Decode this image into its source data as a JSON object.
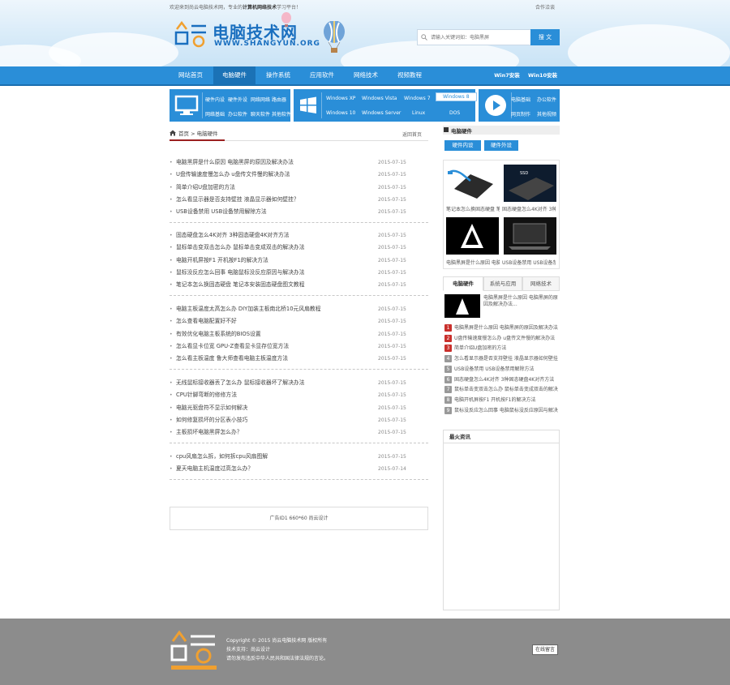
{
  "header": {
    "welcome_pre": "欢迎来到尚云电脑技术网，专业的",
    "welcome_bold": "计算机网络技术",
    "welcome_post": "学习平台！",
    "cooperation": "合作洽谈",
    "logo_cn": "电脑技术网",
    "logo_en": "WWW.SHANGYUN.ORG",
    "search_placeholder": "请输入关键词如：电脑黑屏",
    "search_button": "搜 文"
  },
  "nav": {
    "items": [
      "网站首页",
      "电脑硬件",
      "操作系统",
      "应用软件",
      "网络技术",
      "视频教程"
    ],
    "right": [
      "Win7安装",
      "Win10安装"
    ]
  },
  "categories": {
    "hardware": [
      "硬件内设",
      "硬件外设",
      "网络网络",
      "路由器",
      "网络基础",
      "办公软件",
      "聊天软件",
      "其他软件"
    ],
    "windows": [
      "Windows XP",
      "Windows Vista",
      "Windows 7",
      "Windows 8",
      "Windows 10",
      "Windows Server",
      "Linux",
      "DOS"
    ],
    "video": [
      "电脑基础",
      "办公软件",
      "网页制作",
      "其他视频"
    ]
  },
  "breadcrumb": {
    "home": "首页",
    "sep": ">",
    "current": "电脑硬件",
    "back": "返回首页"
  },
  "list": [
    [
      {
        "title": "电脑黑屏是什么原因 电脑黑屏的原因及解决办法",
        "date": "2015-07-15"
      },
      {
        "title": "U盘传输速度慢怎么办 u盘传文件慢的解决办法",
        "date": "2015-07-15"
      },
      {
        "title": "简单介绍U盘加密的方法",
        "date": "2015-07-15"
      },
      {
        "title": "怎么看显示器是否支持壁挂 液晶显示器如何壁挂？",
        "date": "2015-07-15"
      },
      {
        "title": "USB设备禁用 USB设备禁用解除方法",
        "date": "2015-07-15"
      }
    ],
    [
      {
        "title": "固态硬盘怎么4K对齐 3种固态硬盘4K对齐方法",
        "date": "2015-07-15"
      },
      {
        "title": "鼠标单击变双击怎么办 鼠标单击变成双击的解决办法",
        "date": "2015-07-15"
      },
      {
        "title": "电脑开机屏按F1 开机按F1的解决方法",
        "date": "2015-07-15"
      },
      {
        "title": "鼠标没反应怎么回事 电脑鼠标没反应原因与解决办法",
        "date": "2015-07-15"
      },
      {
        "title": "笔记本怎么换固态硬盘 笔记本安装固态硬盘图文教程",
        "date": "2015-07-15"
      }
    ],
    [
      {
        "title": "电脑主板温度太高怎么办 DIY加装主板南北桥10元风扇教程",
        "date": "2015-07-15"
      },
      {
        "title": "怎么查看电脑配置好不好",
        "date": "2015-07-15"
      },
      {
        "title": "有效优化电脑主板系统的BIOS设置",
        "date": "2015-07-15"
      },
      {
        "title": "怎么看显卡位宽 GPU-Z查看显卡显存位宽方法",
        "date": "2015-07-15"
      },
      {
        "title": "怎么看主板温度 鲁大师查看电脑主板温度方法",
        "date": "2015-07-15"
      }
    ],
    [
      {
        "title": "无线鼠标接收器丢了怎么办 鼠标接收器坏了解决办法",
        "date": "2015-07-15"
      },
      {
        "title": "CPU针脚弯断的修修方法",
        "date": "2015-07-15"
      },
      {
        "title": "电脑光驱盘符不显示如何解决",
        "date": "2015-07-15"
      },
      {
        "title": "如何修复损坏的分区表小技巧",
        "date": "2015-07-15"
      },
      {
        "title": "主板损坏电脑黑屏怎么办？",
        "date": "2015-07-15"
      }
    ],
    [
      {
        "title": "cpu风扇怎么拆，如何拆cpu风扇图解",
        "date": "2015-07-15"
      },
      {
        "title": "夏天电脑主机温度过高怎么办？",
        "date": "2015-07-14"
      }
    ]
  ],
  "ad": "广告ID1 660*60 尚云设计",
  "sidebar": {
    "section_title": "电脑硬件",
    "buttons": [
      "硬件内设",
      "硬件外设"
    ],
    "pics": [
      "笔记本怎么换固态硬盘 笔",
      "固态硬盘怎么4K对齐 3种",
      "电脑黑屏是什么原因 电脑",
      "USB设备禁用 USB设备禁"
    ],
    "tabs": [
      "电脑硬件",
      "系统与应用",
      "网络技术"
    ],
    "featured": "电脑黑屏是什么原因 电脑黑屏的原因及解决办法...",
    "ranks": [
      "电脑黑屏是什么原因 电脑黑屏的原因及解决办法",
      "U盘传输速度慢怎么办 u盘传文件慢的解决办法",
      "简单介绍U盘加密的方法",
      "怎么看显示器是否支持壁挂 液晶显示器如何壁挂",
      "USB设备禁用 USB设备禁用解除方法",
      "固态硬盘怎么4K对齐 3种固态硬盘4K对齐方法",
      "鼠标单击变双击怎么办 鼠标单击变成双击的解决",
      "电脑开机屏按F1 开机按F1的解决方法",
      "鼠标没反应怎么回事 电脑鼠标没反应原因与解决"
    ],
    "rank_numbers": [
      "1",
      "2",
      "3",
      "4",
      "5",
      "6",
      "7",
      "8",
      "9"
    ],
    "latest_title": "最火资讯"
  },
  "footer": {
    "copyright": "Copyright © 2015 尚云电脑技术网 版权所有",
    "support": "技术支持：尚云设计",
    "notice": "请勿发布违反中华人民共和国法律法规的言论。",
    "message_button": "在线留言"
  },
  "colors": {
    "primary": "#2a8ed8",
    "nav_active": "#1b72b6",
    "rank_red": "#c9302c",
    "footer_bg": "#8c8c8c",
    "accent_orange": "#f0a030"
  }
}
